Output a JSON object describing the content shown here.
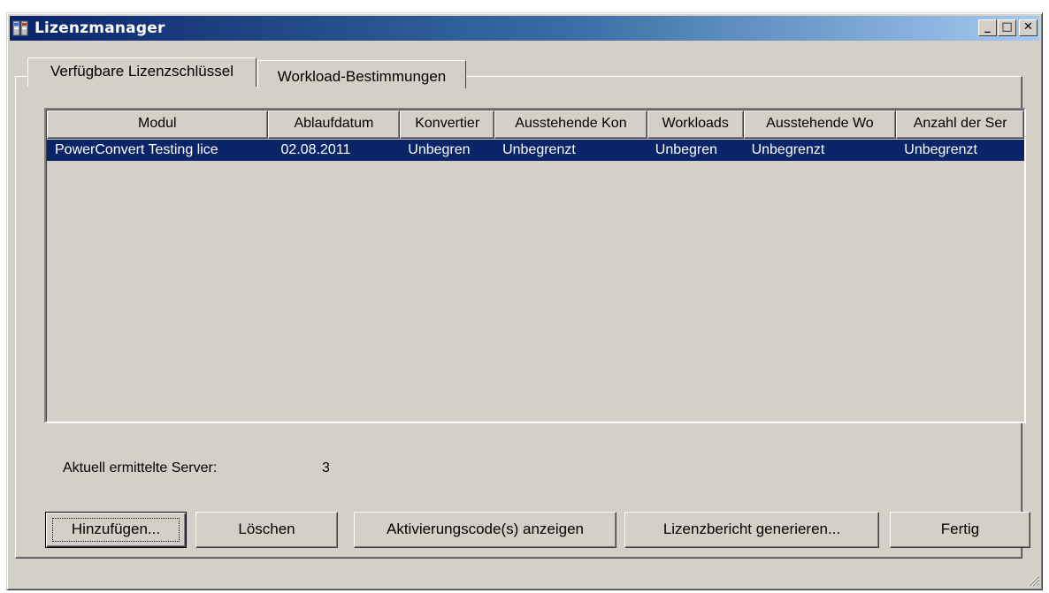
{
  "window": {
    "title": "Lizenzmanager",
    "minimize_glyph": "_",
    "maximize_glyph": "□",
    "close_glyph": "✕"
  },
  "tabs": [
    {
      "label": "Verfügbare Lizenzschlüssel",
      "active": true
    },
    {
      "label": "Workload-Bestimmungen",
      "active": false
    }
  ],
  "table": {
    "columns": [
      "Modul",
      "Ablaufdatum",
      "Konvertier",
      "Ausstehende Kon",
      "Workloads",
      "Ausstehende Wo",
      "Anzahl der Ser"
    ],
    "rows": [
      [
        "PowerConvert Testing lice",
        "02.08.2011",
        "Unbegren",
        "Unbegrenzt",
        "Unbegren",
        "Unbegrenzt",
        "Unbegrenzt"
      ]
    ]
  },
  "status": {
    "label": "Aktuell ermittelte Server:",
    "value": "3"
  },
  "buttons": {
    "add": "Hinzufügen...",
    "delete": "Löschen",
    "show_activation": "Aktivierungscode(s) anzeigen",
    "generate_report": "Lizenzbericht generieren...",
    "done": "Fertig"
  },
  "colors": {
    "titlebar_start": "#0a246a",
    "titlebar_end": "#a6caf0",
    "face": "#d4d0c8",
    "selection": "#0a246a"
  },
  "icons": {
    "app": "lizenzmanager-app-icon",
    "grip": "resize-grip-icon"
  }
}
